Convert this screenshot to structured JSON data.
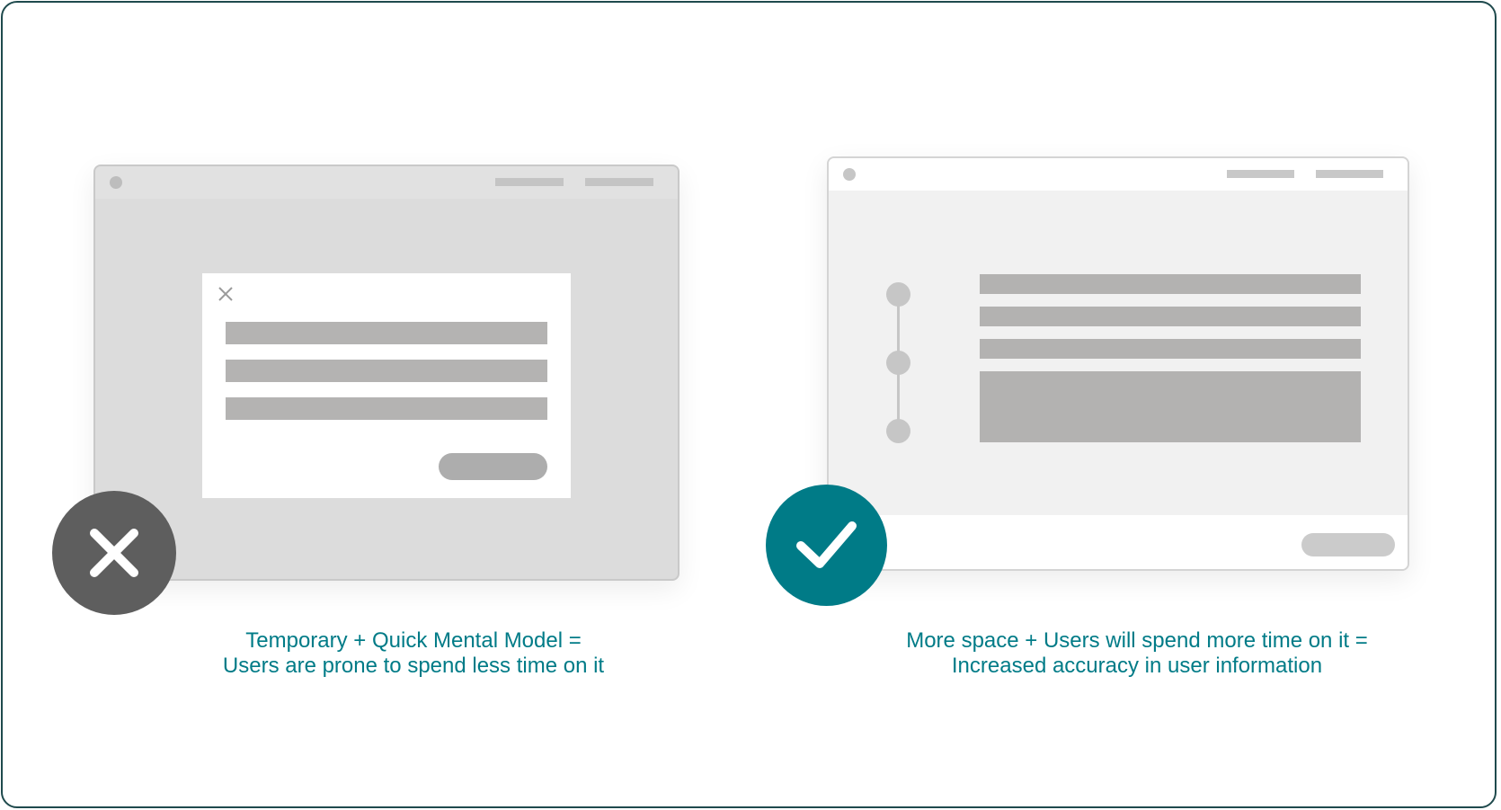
{
  "left_panel": {
    "status": "incorrect",
    "caption_line1": "Temporary + Quick Mental Model =",
    "caption_line2": "Users are prone to spend less time on it",
    "badge_icon": "close-icon",
    "badge_color": "#5e5e5e",
    "modal_close_icon": "close-icon"
  },
  "right_panel": {
    "status": "correct",
    "caption_line1": "More space + Users will spend more time on it =",
    "caption_line2": "Increased accuracy in user information",
    "badge_icon": "check-icon",
    "badge_color": "#007b87"
  },
  "colors": {
    "accent": "#007b87",
    "frame_border": "#1f4a4d",
    "placeholder": "#b4b3b2"
  }
}
